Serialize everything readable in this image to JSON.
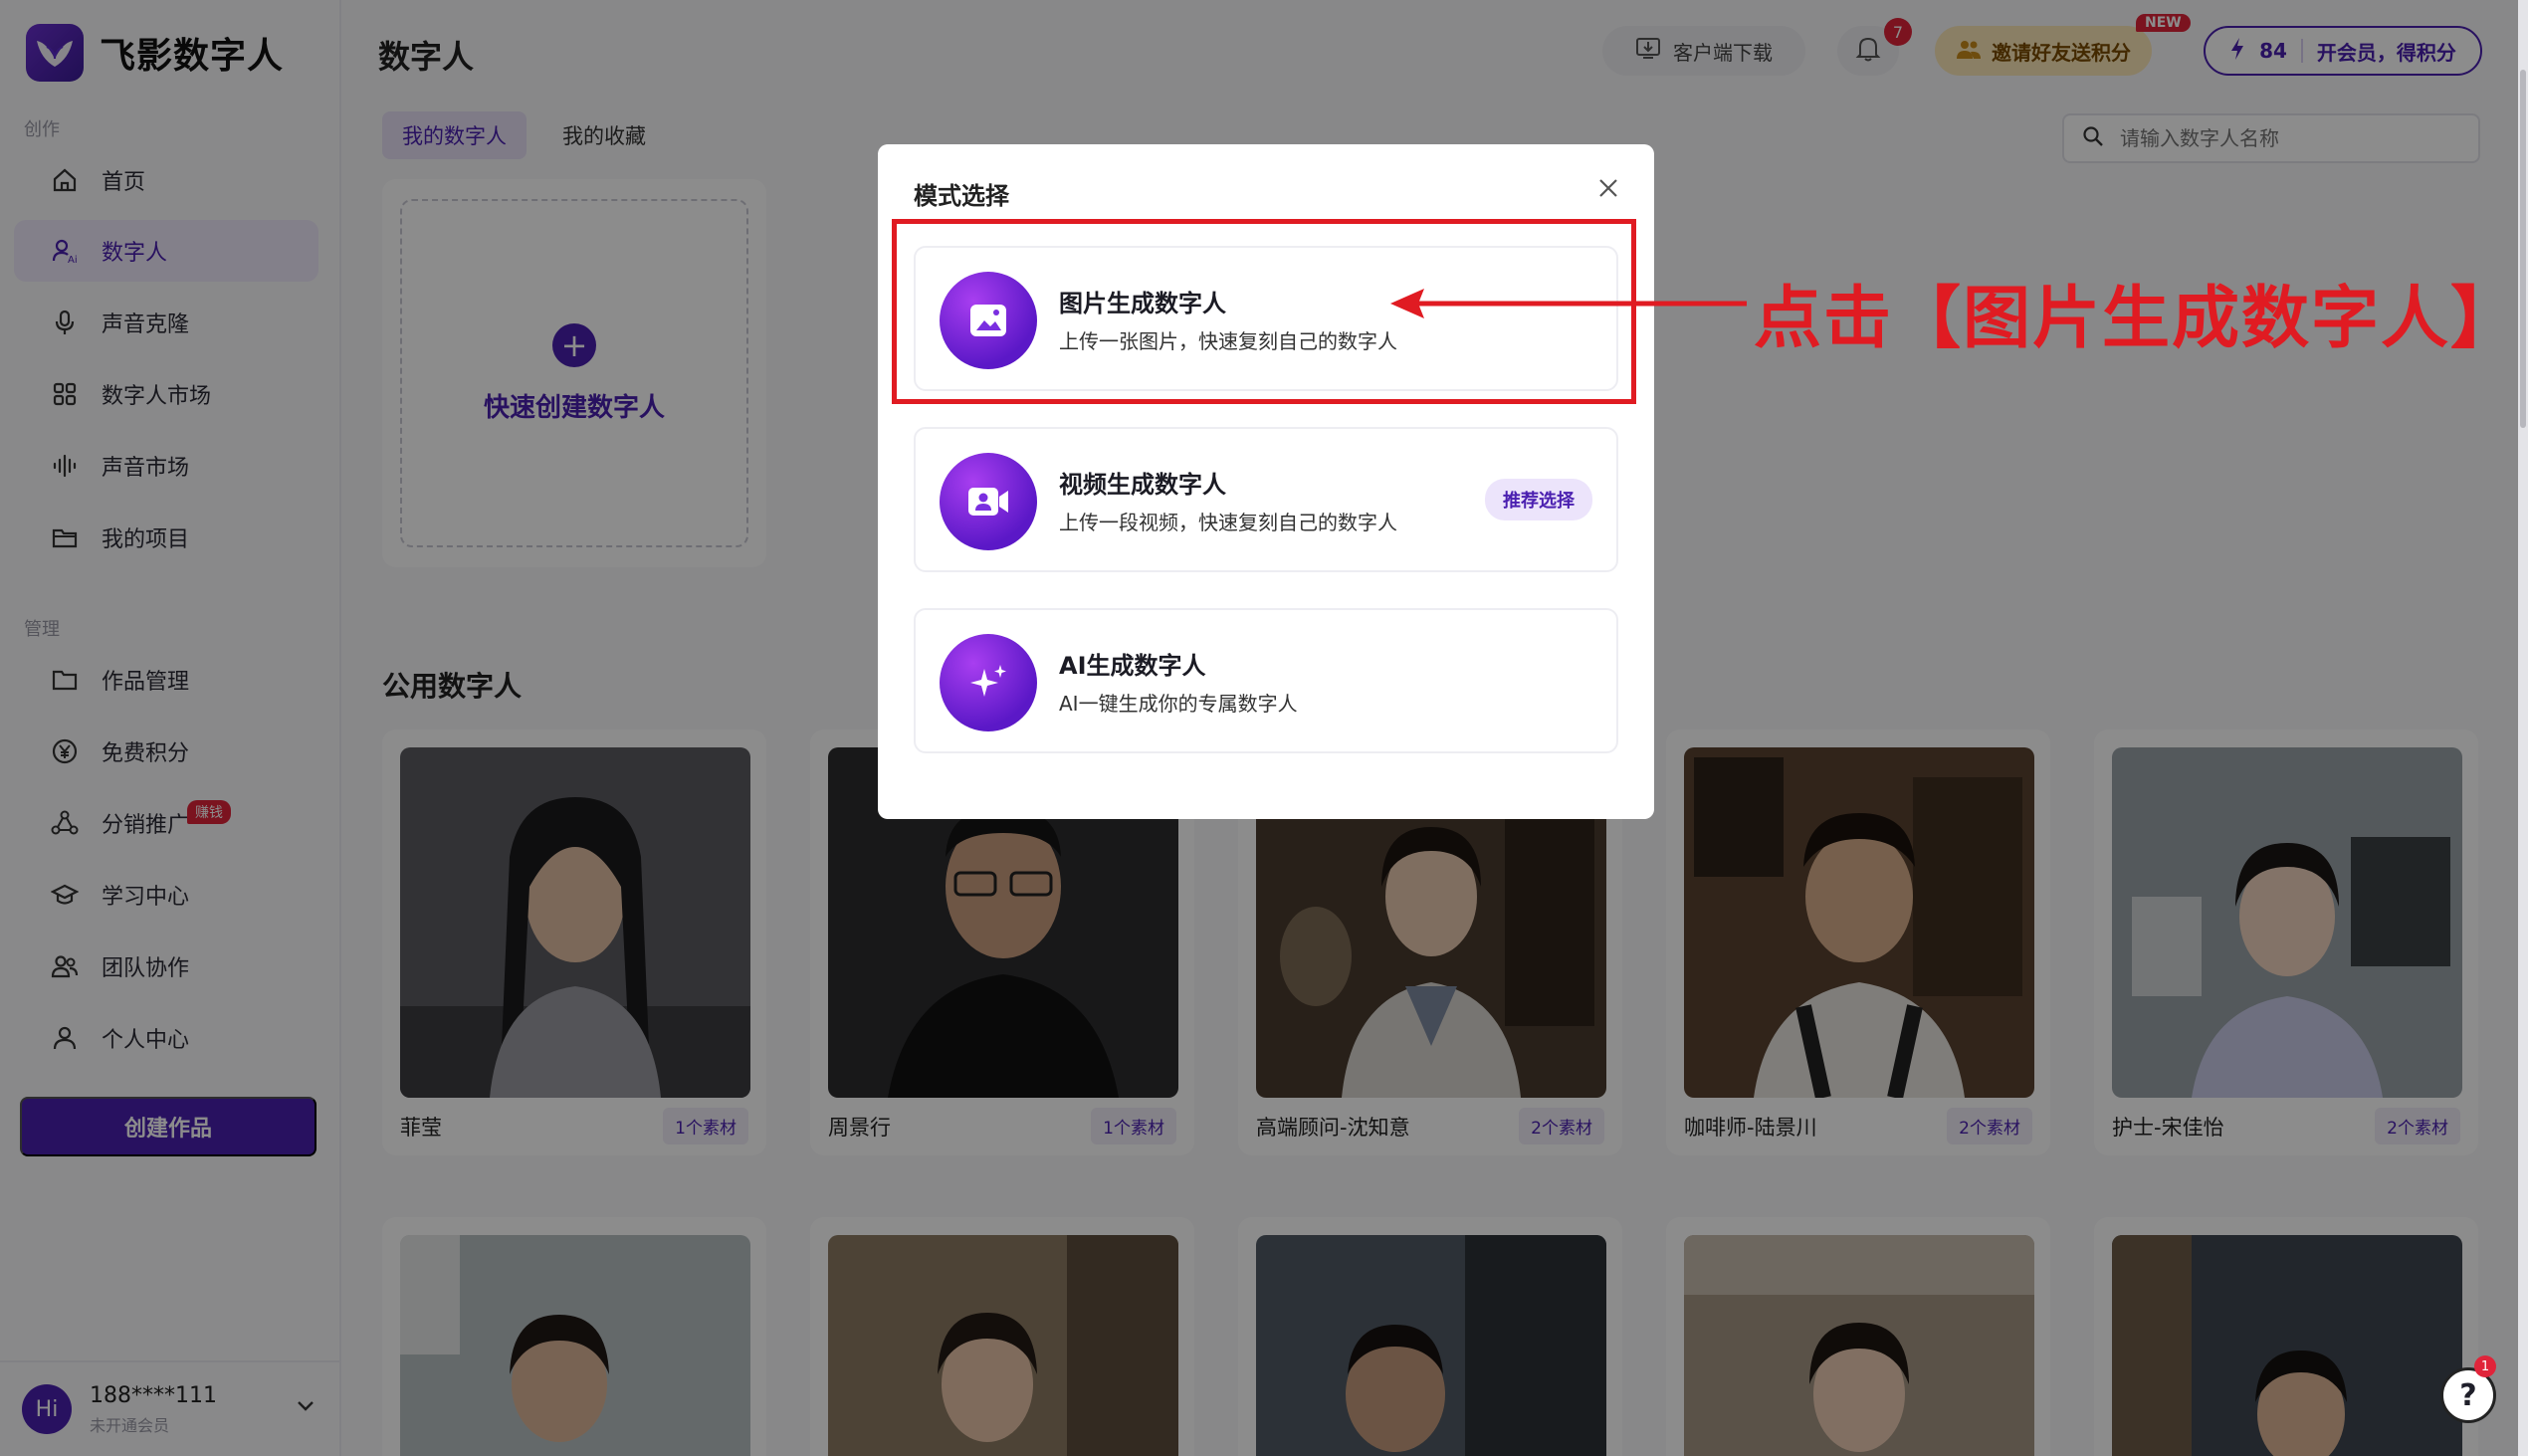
{
  "brand": {
    "name": "飞影数字人"
  },
  "sidebar": {
    "section_create": "创作",
    "section_manage": "管理",
    "items": [
      {
        "label": "首页",
        "icon": "home-icon"
      },
      {
        "label": "数字人",
        "icon": "digital-human-icon"
      },
      {
        "label": "声音克隆",
        "icon": "microphone-icon"
      },
      {
        "label": "数字人市场",
        "icon": "grid-icon"
      },
      {
        "label": "声音市场",
        "icon": "soundwave-icon"
      },
      {
        "label": "我的项目",
        "icon": "folder-icon"
      },
      {
        "label": "作品管理",
        "icon": "folder-outline-icon"
      },
      {
        "label": "免费积分",
        "icon": "yen-coin-icon"
      },
      {
        "label": "分销推广",
        "icon": "share-network-icon",
        "badge": "赚钱"
      },
      {
        "label": "学习中心",
        "icon": "graduation-cap-icon"
      },
      {
        "label": "团队协作",
        "icon": "team-icon"
      },
      {
        "label": "个人中心",
        "icon": "user-icon"
      }
    ],
    "create_button": "创建作品",
    "user": {
      "avatar": "Hi",
      "name": "188****111",
      "status": "未开通会员"
    }
  },
  "header": {
    "title": "数字人",
    "download": "客户端下载",
    "bell_count": "7",
    "invite": "邀请好友送积分",
    "new_badge": "NEW",
    "points": "84",
    "membership": "开会员，得积分"
  },
  "tabs": [
    "我的数字人",
    "我的收藏"
  ],
  "search": {
    "placeholder": "请输入数字人名称"
  },
  "quick_create": {
    "label": "快速创建数字人"
  },
  "public_section": {
    "title": "公用数字人"
  },
  "cards": [
    {
      "name": "菲莹",
      "count": "1个素材"
    },
    {
      "name": "周景行",
      "count": "1个素材"
    },
    {
      "name": "高端顾问-沈知意",
      "count": "2个素材"
    },
    {
      "name": "咖啡师-陆景川",
      "count": "2个素材"
    },
    {
      "name": "护士-宋佳怡",
      "count": "2个素材"
    }
  ],
  "modal": {
    "title": "模式选择",
    "options": [
      {
        "title": "图片生成数字人",
        "desc": "上传一张图片，快速复刻自己的数字人",
        "icon": "image-icon"
      },
      {
        "title": "视频生成数字人",
        "desc": "上传一段视频，快速复刻自己的数字人",
        "icon": "video-icon",
        "badge": "推荐选择"
      },
      {
        "title": "AI生成数字人",
        "desc": "AI一键生成你的专属数字人",
        "icon": "sparkle-icon"
      }
    ]
  },
  "annotation": {
    "text": "点击【图片生成数字人】",
    "color": "#e01b22"
  },
  "help": {
    "badge": "1"
  },
  "colors": {
    "accent": "#4a1fb0",
    "danger": "#e0243a"
  }
}
